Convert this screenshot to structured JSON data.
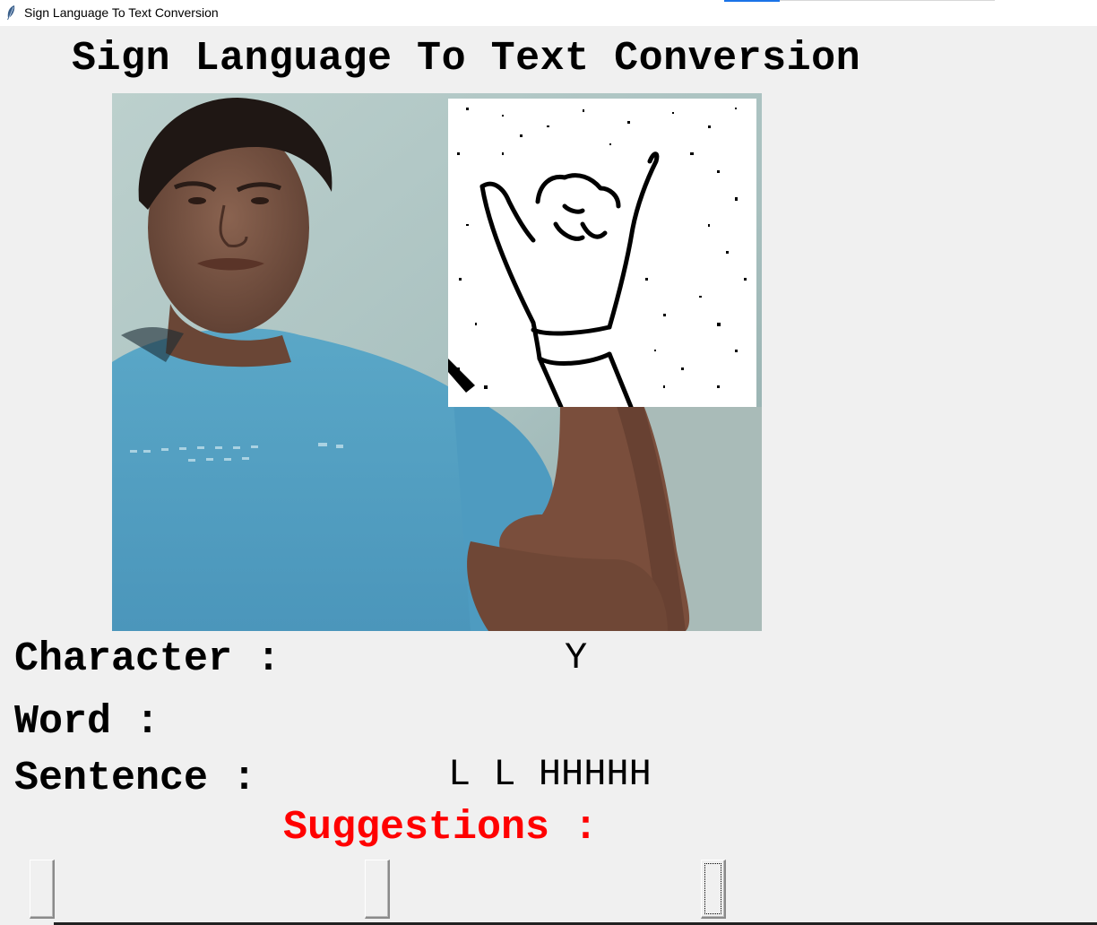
{
  "window": {
    "title": "Sign Language To Text Conversion",
    "icon": "feather-icon"
  },
  "heading": "Sign Language To Text Conversion",
  "panels": {
    "camera_feed": "camera-feed",
    "hand_mask": "hand-mask"
  },
  "character": {
    "label": "Character :",
    "value": "Y"
  },
  "word": {
    "label": "Word :",
    "value": ""
  },
  "sentence": {
    "label": "Sentence :",
    "value": "L L HHHHH"
  },
  "suggestions": {
    "label": "Suggestions :",
    "buttons": [
      "",
      "",
      ""
    ],
    "label_color": "#ff0000"
  },
  "colors": {
    "background": "#f0f0f0",
    "text": "#000000",
    "suggestion": "#ff0000"
  }
}
